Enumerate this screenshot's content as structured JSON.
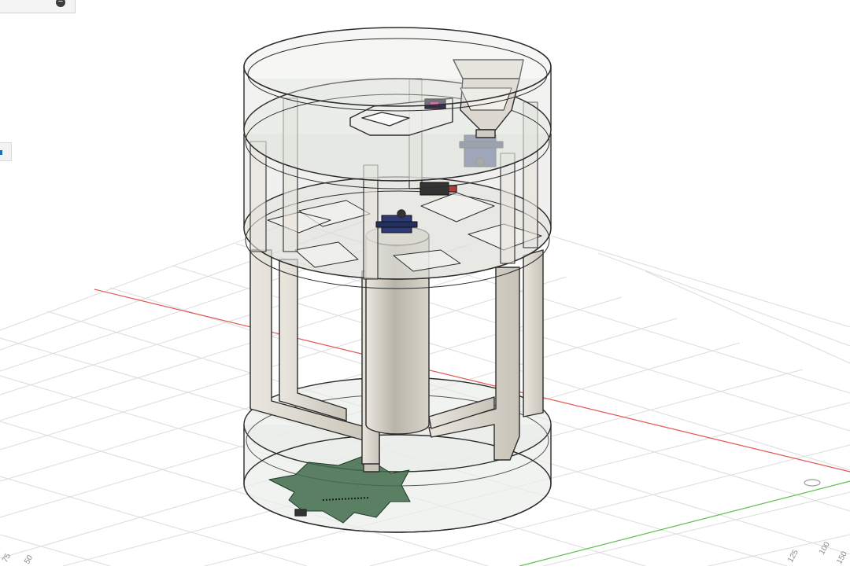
{
  "app": {
    "name": "3D CAD modeling viewport"
  },
  "browser_panel": {
    "collapse_icon": "minus-circle-icon",
    "collapse_glyph": "−"
  },
  "left_edge_tab": {
    "icon": "panel-tab-icon"
  },
  "grid": {
    "x_axis_color": "#e0574f",
    "y_axis_color": "#5fbf4f",
    "grid_color": "#dcdcdc",
    "ruler_labels": [
      "100",
      "125",
      "150",
      "75",
      "50"
    ]
  },
  "model": {
    "body_color": "#dfdcd4",
    "transparent_color": "#c9ccc6",
    "pcb_color": "#3f6a4a",
    "servo_color": "#2d3a78",
    "accent_color": "#c2378f"
  }
}
